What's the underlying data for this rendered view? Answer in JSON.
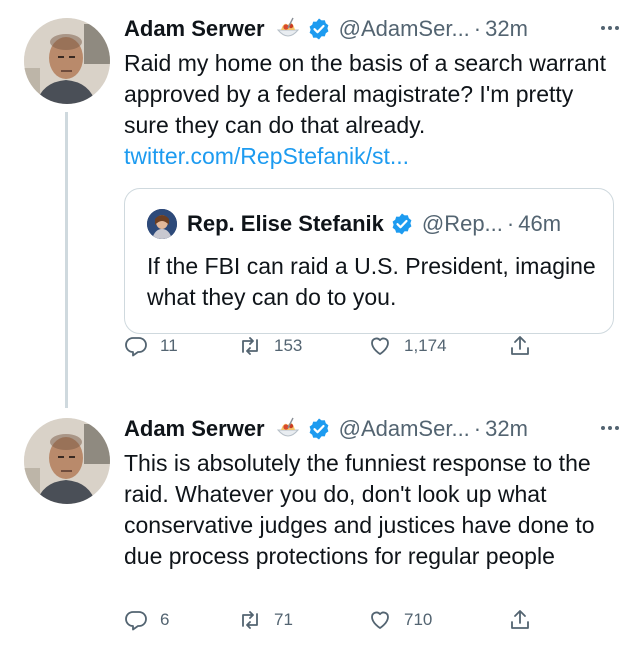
{
  "tweets": [
    {
      "author": {
        "name": "Adam Serwer",
        "handle": "@AdamSer...",
        "emoji": "spaghetti-emoji"
      },
      "time": "32m",
      "text": "Raid my home on the basis of a search warrant approved by a federal magistrate? I'm pretty sure they can do that already.",
      "link": "twitter.com/RepStefanik/st...",
      "quote": {
        "name": "Rep. Elise Stefanik",
        "handle": "@Rep...",
        "time": "46m",
        "text": "If the FBI can raid a U.S. President, imagine what they can do to you."
      },
      "stats": {
        "replies": "11",
        "retweets": "153",
        "likes": "1,174"
      }
    },
    {
      "author": {
        "name": "Adam Serwer",
        "handle": "@AdamSer...",
        "emoji": "spaghetti-emoji"
      },
      "time": "32m",
      "text": "This is absolutely the funniest response to the raid. Whatever you do, don't look up what conservative judges and justices have done to due process protections for regular people",
      "stats": {
        "replies": "6",
        "retweets": "71",
        "likes": "710"
      }
    }
  ],
  "separator": "·",
  "colors": {
    "accent": "#1d9bf0",
    "secondary_text": "#536471",
    "border": "#cfd9de"
  }
}
